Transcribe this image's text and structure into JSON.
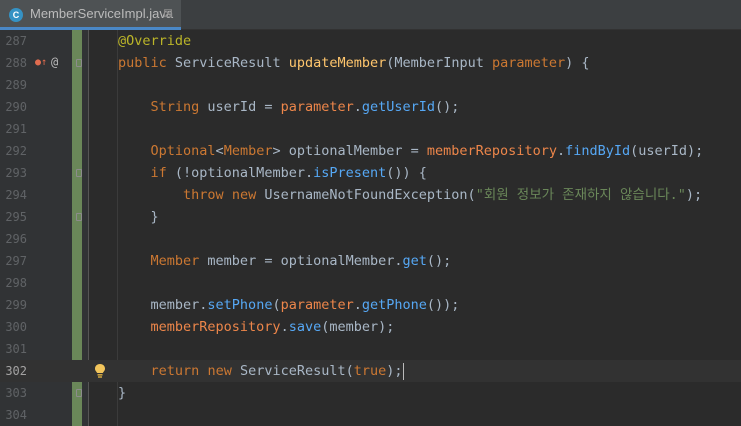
{
  "tab": {
    "icon_letter": "C",
    "label": "MemberServiceImpl.java",
    "close_glyph": "⊠"
  },
  "gutter": {
    "line_numbers": [
      "287",
      "288",
      "289",
      "290",
      "291",
      "292",
      "293",
      "294",
      "295",
      "296",
      "297",
      "298",
      "299",
      "300",
      "301",
      "302",
      "303",
      "304"
    ]
  },
  "code": {
    "annotation": "@Override",
    "l288": {
      "kw": "public",
      "ret": "ServiceResult",
      "method": "updateMember",
      "open": "(",
      "ptype": "MemberInput",
      "pname": "parameter",
      "close": ") {"
    },
    "l290": {
      "type": "String",
      "var": " userId = ",
      "field": "parameter",
      "dot": ".",
      "call": "getUserId",
      "end": "();"
    },
    "l292": {
      "type1": "Optional",
      "lt": "<",
      "type2": "Member",
      "rest": "> optionalMember = ",
      "field": "memberRepository",
      "dot": ".",
      "call": "findById",
      "end": "(userId);"
    },
    "l293": {
      "kw": "if",
      "mid": " (!optionalMember.",
      "call": "isPresent",
      "end": "()) {"
    },
    "l294": {
      "kw1": "throw",
      "kw2": "new",
      "type": "UsernameNotFoundException",
      "open": "(",
      "str": "\"회원 정보가 존재하지 않습니다.\"",
      "end": ");"
    },
    "l295": {
      "text": "}"
    },
    "l297": {
      "type": "Member",
      "var": " member = optionalMember.",
      "call": "get",
      "end": "();"
    },
    "l299": {
      "var": "member.",
      "call": "setPhone",
      "open": "(",
      "field": "parameter",
      "dot": ".",
      "call2": "getPhone",
      "end": "());"
    },
    "l300": {
      "field": "memberRepository",
      "dot": ".",
      "call": "save",
      "end": "(member);"
    },
    "l302": {
      "kw1": "return",
      "kw2": "new",
      "type": "ServiceResult",
      "open": "(",
      "lit": "true",
      "end": ");"
    },
    "l303": {
      "text": "}"
    }
  },
  "colors": {
    "background": "#2b2b2b",
    "keyword": "#cc7832",
    "annotation": "#bbb529",
    "method": "#ffc66d",
    "field": "#ed864a",
    "string": "#6a8759",
    "vcs_modified": "#6a8759"
  },
  "icons": {
    "implements": "implements-override-icon",
    "annotation": "at-icon",
    "fold": "fold-marker-icon",
    "intention": "lightbulb-icon"
  }
}
